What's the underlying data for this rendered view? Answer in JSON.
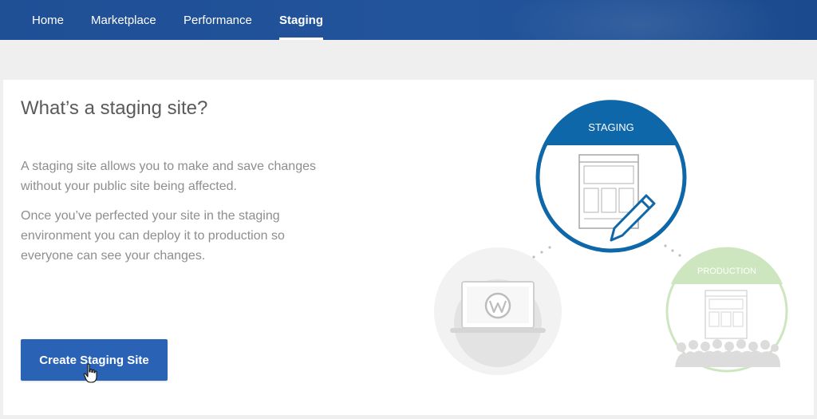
{
  "nav": {
    "items": [
      {
        "label": "Home"
      },
      {
        "label": "Marketplace"
      },
      {
        "label": "Performance"
      },
      {
        "label": "Staging",
        "active": true
      }
    ]
  },
  "main": {
    "title": "What’s a staging site?",
    "paragraph1": "A staging site allows you to make and save changes without your public site being affected.",
    "paragraph2": "Once you’ve perfected your site in the staging environment you can deploy it to production so everyone can see your changes.",
    "cta_label": "Create Staging Site"
  },
  "illustration": {
    "staging_label": "STAGING",
    "production_label": "PRODUCTION",
    "icons": [
      "laptop-wordpress-icon",
      "staging-webpage-pencil-icon",
      "production-webpage-audience-icon"
    ]
  },
  "colors": {
    "nav_bg": "#22549c",
    "staging_blue": "#0e67a8",
    "production_green": "#b6dba1",
    "cta_blue": "#2a63b6"
  }
}
